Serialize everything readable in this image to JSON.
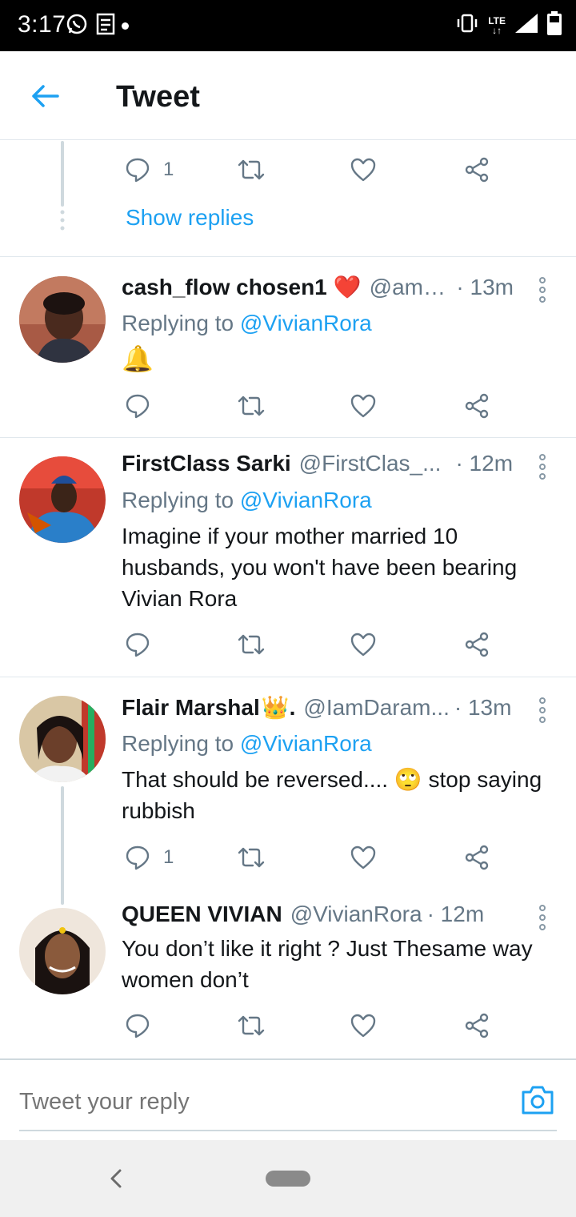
{
  "status_bar": {
    "time": "3:17",
    "network": "LTE",
    "icons": [
      "whatsapp-icon",
      "news-icon",
      "vibrate-icon",
      "signal-icon",
      "battery-icon"
    ]
  },
  "header": {
    "title": "Tweet",
    "back_icon": "arrow-left-icon"
  },
  "top_thread": {
    "reply_count": "1",
    "show_replies_label": "Show replies"
  },
  "tweets": [
    {
      "name": "cash_flow chosen1",
      "name_emoji": "❤️",
      "handle": "@amc...",
      "time": "· 13m",
      "replying_prefix": "Replying to ",
      "replying_handle": "@VivianRora",
      "text": "🔔",
      "reply_count": ""
    },
    {
      "name": "FirstClass Sarki",
      "name_emoji": "",
      "handle": "@FirstClas_...",
      "time": "· 12m",
      "replying_prefix": "Replying to ",
      "replying_handle": "@VivianRora",
      "text": "Imagine if your mother married 10 husbands, you won't have been bearing Vivian Rora",
      "reply_count": ""
    },
    {
      "name": "Flair Marshal",
      "name_emoji": "👑.",
      "handle": "@IamDaram...",
      "time": "· 13m",
      "replying_prefix": "Replying to ",
      "replying_handle": "@VivianRora",
      "text": "That should be reversed.... 🙄 stop saying rubbish",
      "reply_count": "1"
    },
    {
      "name": "QUEEN VIVIAN",
      "name_emoji": "",
      "handle": "@VivianRora",
      "time": "· 12m",
      "text": "You don’t like it right ? Just Thesame way women don’t",
      "reply_count": ""
    }
  ],
  "composer": {
    "placeholder": "Tweet your reply",
    "camera_icon": "camera-icon"
  },
  "colors": {
    "accent": "#1da1f2",
    "secondary_text": "#657786",
    "divider": "#e1e8ed"
  }
}
